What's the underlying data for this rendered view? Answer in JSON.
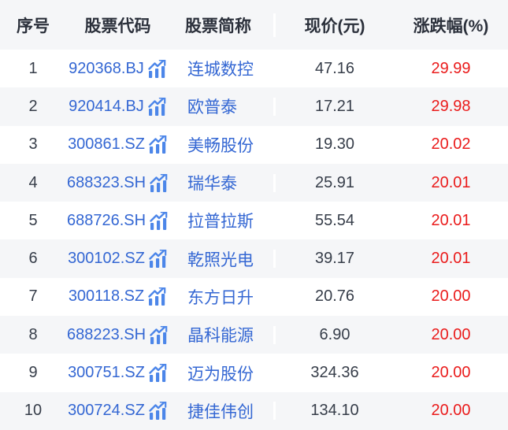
{
  "colors": {
    "header-bg": "#f5f6f8",
    "row-bg": "#ffffff",
    "row-alt-bg": "#f5f6f8",
    "header-text": "#2b303b",
    "body-text": "#363d49",
    "link-blue": "#3467d3",
    "icon-blue": "#4c86e9",
    "change-red": "#ea1b1b",
    "divider": "#ffffff"
  },
  "table": {
    "columns": [
      {
        "id": "index",
        "label": "序号"
      },
      {
        "id": "code",
        "label": "股票代码"
      },
      {
        "id": "name",
        "label": "股票简称"
      },
      {
        "id": "price",
        "label": "现价(元)"
      },
      {
        "id": "change",
        "label": "涨跌幅(%)"
      }
    ],
    "code_icon": "kline-trend-up-icon",
    "rows": [
      {
        "index": "1",
        "code": "920368.BJ",
        "name": "连城数控",
        "price": "47.16",
        "change": "29.99"
      },
      {
        "index": "2",
        "code": "920414.BJ",
        "name": "欧普泰",
        "price": "17.21",
        "change": "29.98"
      },
      {
        "index": "3",
        "code": "300861.SZ",
        "name": "美畅股份",
        "price": "19.30",
        "change": "20.02"
      },
      {
        "index": "4",
        "code": "688323.SH",
        "name": "瑞华泰",
        "price": "25.91",
        "change": "20.01"
      },
      {
        "index": "5",
        "code": "688726.SH",
        "name": "拉普拉斯",
        "price": "55.54",
        "change": "20.01"
      },
      {
        "index": "6",
        "code": "300102.SZ",
        "name": "乾照光电",
        "price": "39.17",
        "change": "20.01"
      },
      {
        "index": "7",
        "code": "300118.SZ",
        "name": "东方日升",
        "price": "20.76",
        "change": "20.00"
      },
      {
        "index": "8",
        "code": "688223.SH",
        "name": "晶科能源",
        "price": "6.90",
        "change": "20.00"
      },
      {
        "index": "9",
        "code": "300751.SZ",
        "name": "迈为股份",
        "price": "324.36",
        "change": "20.00"
      },
      {
        "index": "10",
        "code": "300724.SZ",
        "name": "捷佳伟创",
        "price": "134.10",
        "change": "20.00"
      }
    ]
  }
}
